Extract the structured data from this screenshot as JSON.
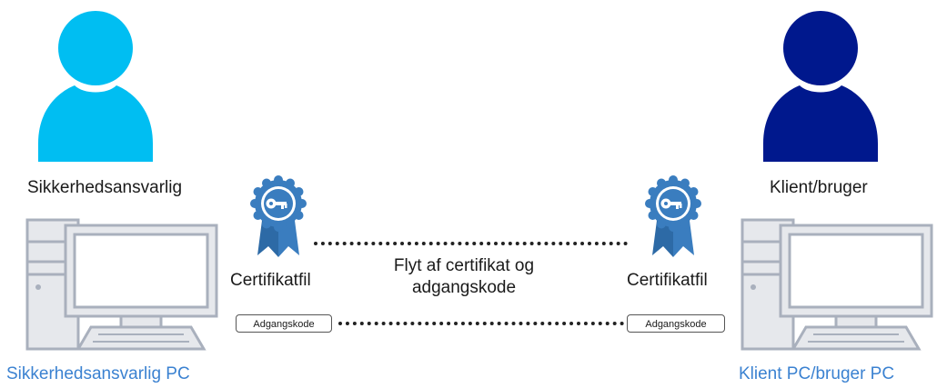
{
  "left": {
    "person_label": "Sikkerhedsansvarlig",
    "person_color": "#00bef2",
    "certificate_label": "Certifikatfil",
    "password_label": "Adgangskode",
    "pc_label": "Sikkerhedsansvarlig PC"
  },
  "right": {
    "person_label": "Klient/bruger",
    "person_color": "#00188d",
    "certificate_label": "Certifikatfil",
    "password_label": "Adgangskode",
    "pc_label": "Klient PC/bruger PC"
  },
  "transfer": {
    "line1": "Flyt af certifikat og",
    "line2": "adgangskode"
  },
  "colors": {
    "pc_label": "#3b82d1",
    "computer_outline": "#a9b0bd",
    "computer_fill": "#e6e8ec",
    "badge": "#3a7dbf",
    "badge_ribbon": "#2d6aa6"
  },
  "icons": {
    "person": "person-icon",
    "certificate": "certificate-badge-icon",
    "computer": "desktop-computer-icon"
  }
}
